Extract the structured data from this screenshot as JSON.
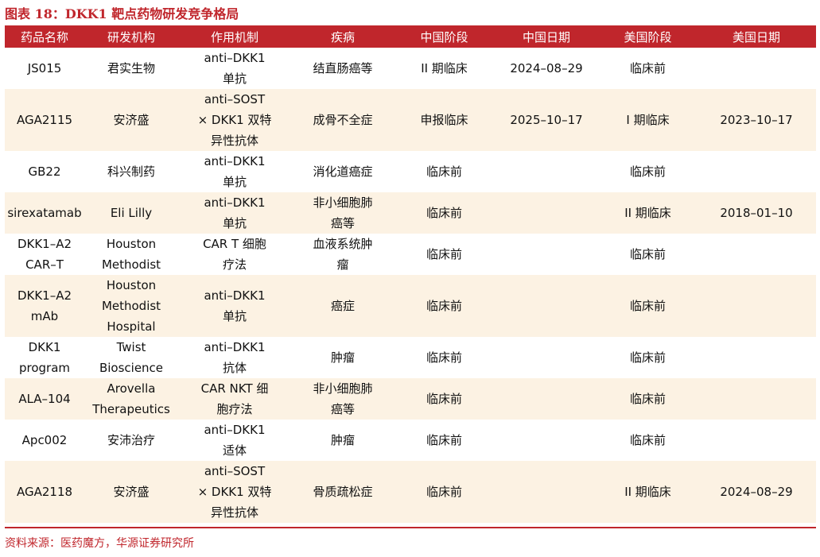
{
  "title": "图表 18：DKK1 靶点药物研发竞争格局",
  "headers": [
    "药品名称",
    "研发机构",
    "作用机制",
    "疾病",
    "中国阶段",
    "中国日期",
    "美国阶段",
    "美国日期"
  ],
  "rows": [
    {
      "name": [
        "JS015"
      ],
      "org": [
        "君实生物"
      ],
      "mech": [
        "anti–DKK1",
        "单抗"
      ],
      "disease": [
        "结直肠癌等"
      ],
      "cn_stage": "II 期临床",
      "cn_date": "2024–08–29",
      "us_stage": "临床前",
      "us_date": ""
    },
    {
      "name": [
        "AGA2115"
      ],
      "org": [
        "安济盛"
      ],
      "mech": [
        "anti–SOST",
        "× DKK1 双特",
        "异性抗体"
      ],
      "disease": [
        "成骨不全症"
      ],
      "cn_stage": "申报临床",
      "cn_date": "2025–10–17",
      "us_stage": "I 期临床",
      "us_date": "2023–10–17"
    },
    {
      "name": [
        "GB22"
      ],
      "org": [
        "科兴制药"
      ],
      "mech": [
        "anti–DKK1",
        "单抗"
      ],
      "disease": [
        "消化道癌症"
      ],
      "cn_stage": "临床前",
      "cn_date": "",
      "us_stage": "临床前",
      "us_date": ""
    },
    {
      "name": [
        "sirexatamab"
      ],
      "org": [
        "Eli Lilly"
      ],
      "mech": [
        "anti–DKK1",
        "单抗"
      ],
      "disease": [
        "非小细胞肺",
        "癌等"
      ],
      "cn_stage": "临床前",
      "cn_date": "",
      "us_stage": "II 期临床",
      "us_date": "2018–01–10"
    },
    {
      "name": [
        "DKK1–A2",
        "CAR–T"
      ],
      "org": [
        "Houston",
        "Methodist"
      ],
      "mech": [
        "CAR T 细胞",
        "疗法"
      ],
      "disease": [
        "血液系统肿",
        "瘤"
      ],
      "cn_stage": "临床前",
      "cn_date": "",
      "us_stage": "临床前",
      "us_date": ""
    },
    {
      "name": [
        "DKK1–A2",
        "mAb"
      ],
      "org": [
        "Houston",
        "Methodist",
        "Hospital"
      ],
      "mech": [
        "anti–DKK1",
        "单抗"
      ],
      "disease": [
        "癌症"
      ],
      "cn_stage": "临床前",
      "cn_date": "",
      "us_stage": "临床前",
      "us_date": ""
    },
    {
      "name": [
        "DKK1",
        "program"
      ],
      "org": [
        "Twist",
        "Bioscience"
      ],
      "mech": [
        "anti–DKK1",
        "抗体"
      ],
      "disease": [
        "肿瘤"
      ],
      "cn_stage": "临床前",
      "cn_date": "",
      "us_stage": "临床前",
      "us_date": ""
    },
    {
      "name": [
        "ALA–104"
      ],
      "org": [
        "Arovella",
        "Therapeutics"
      ],
      "mech": [
        "CAR NKT 细",
        "胞疗法"
      ],
      "disease": [
        "非小细胞肺",
        "癌等"
      ],
      "cn_stage": "临床前",
      "cn_date": "",
      "us_stage": "临床前",
      "us_date": ""
    },
    {
      "name": [
        "Apc002"
      ],
      "org": [
        "安沛治疗"
      ],
      "mech": [
        "anti–DKK1",
        "适体"
      ],
      "disease": [
        "肿瘤"
      ],
      "cn_stage": "临床前",
      "cn_date": "",
      "us_stage": "临床前",
      "us_date": ""
    },
    {
      "name": [
        "AGA2118"
      ],
      "org": [
        "安济盛"
      ],
      "mech": [
        "anti–SOST",
        "× DKK1 双特",
        "异性抗体"
      ],
      "disease": [
        "骨质疏松症"
      ],
      "cn_stage": "临床前",
      "cn_date": "",
      "us_stage": "II 期临床",
      "us_date": "2024–08–29"
    }
  ],
  "source": "资料来源：医药魔方，华源证券研究所",
  "colors": {
    "accent": "#c0262c",
    "stripe": "#fcf2e3"
  }
}
